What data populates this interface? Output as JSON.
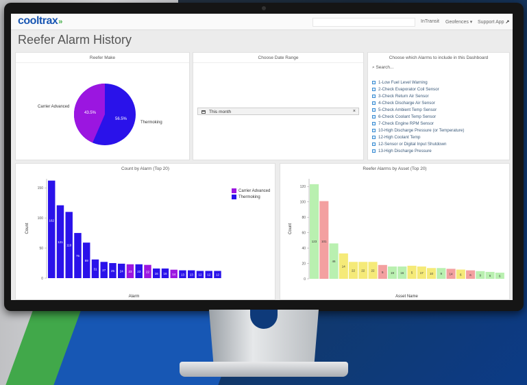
{
  "app": {
    "logo": "cooltrax",
    "logo_sub": "",
    "nav": {
      "intransit": "InTransit",
      "geofences": "Geofences ▾",
      "support": "Support App"
    },
    "page_title": "Reefer Alarm History"
  },
  "reefer_make": {
    "title": "Reefer Make",
    "labels": [
      "Carrier Advanced",
      "Thermoking"
    ],
    "pct_labels": [
      "43.5%",
      "56.5%"
    ]
  },
  "date_range": {
    "title": "Choose Date Range",
    "value": "This month"
  },
  "alarms": {
    "title": "Choose which Alarms to include in this Dashboard",
    "search_placeholder": "Search...",
    "items": [
      "1-Low Fuel Level Warning",
      "2-Check Evaporator Coil Sensor",
      "3-Check Return Air Sensor",
      "4-Check Discharge Air Sensor",
      "5-Check Ambient Temp Sensor",
      "6-Check Coolant Temp Sensor",
      "7-Check Engine RPM Sensor",
      "10-High Discharge Pressure (or Temperature)",
      "12-High Coolant Temp",
      "12-Sensor or Digital Input Shutdown",
      "13-High Discharge Pressure"
    ]
  },
  "colors": {
    "carrier": "#9b16e0",
    "thermoking": "#2a12ea",
    "green": "#b9f0b0",
    "red": "#f3a0a0",
    "yellow": "#f5ea78",
    "accent": "#1a57b3"
  },
  "chart_data": [
    {
      "type": "pie",
      "title": "Reefer Make",
      "labels": [
        "Carrier Advanced",
        "Thermoking"
      ],
      "values": [
        43.5,
        56.5
      ]
    },
    {
      "type": "bar",
      "title": "Count by Alarm (Top 20)",
      "xlabel": "Alarm",
      "ylabel": "Count",
      "ylim": [
        0,
        165
      ],
      "yticks": [
        0,
        50,
        100,
        150
      ],
      "legend": [
        "Carrier Advanced",
        "Thermoking"
      ],
      "legend_position": "top-right",
      "values": [
        162,
        121,
        110,
        75,
        59,
        31,
        27,
        25,
        24,
        23,
        23,
        22,
        16,
        16,
        14,
        13,
        13,
        12,
        12,
        12
      ],
      "makes": [
        "T",
        "T",
        "T",
        "T",
        "T",
        "T",
        "T",
        "T",
        "T",
        "C",
        "T",
        "C",
        "T",
        "T",
        "C",
        "T",
        "T",
        "T",
        "T",
        "T"
      ]
    },
    {
      "type": "bar",
      "title": "Reefer Alarms by Asset (Top 20)",
      "xlabel": "Asset Name",
      "ylabel": "Count",
      "ylim": [
        0,
        130
      ],
      "yticks": [
        0,
        20,
        40,
        60,
        80,
        100,
        120
      ],
      "values": [
        123,
        101,
        46,
        33,
        22,
        22,
        22,
        18,
        16,
        16,
        17,
        16,
        14,
        14,
        13,
        12,
        11,
        10,
        9,
        8
      ],
      "labels": [
        "123",
        "101",
        "46",
        "14",
        "22",
        "22",
        "22",
        "5",
        "19",
        "16",
        "5",
        "17",
        "10",
        "9",
        "14",
        "6",
        "6",
        "9",
        "6",
        "6"
      ],
      "colors": [
        "green",
        "red",
        "green",
        "yellow",
        "yellow",
        "yellow",
        "yellow",
        "red",
        "green",
        "green",
        "yellow",
        "yellow",
        "yellow",
        "green",
        "red",
        "yellow",
        "red",
        "green",
        "green",
        "green"
      ]
    }
  ]
}
